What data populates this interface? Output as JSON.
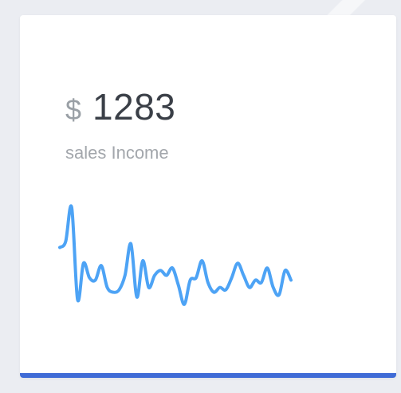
{
  "widget": {
    "currency_symbol": "$",
    "amount": "1283",
    "label": "sales Income"
  },
  "colors": {
    "line": "#4da3f5",
    "accent_bar": "#3f6bd6",
    "background": "#ebedf2",
    "card": "#ffffff"
  },
  "chart_data": {
    "type": "line",
    "title": "",
    "xlabel": "",
    "ylabel": "",
    "x": [
      0,
      1,
      2,
      3,
      4,
      5,
      6,
      7,
      8,
      9,
      10,
      11,
      12,
      13,
      14,
      15,
      16,
      17,
      18,
      19,
      20,
      21,
      22,
      23,
      24,
      25,
      26,
      27,
      28,
      29,
      30,
      31,
      32,
      33,
      34,
      35,
      36,
      37,
      38,
      39
    ],
    "values": [
      55,
      60,
      88,
      12,
      42,
      30,
      28,
      40,
      22,
      18,
      20,
      32,
      58,
      14,
      44,
      22,
      32,
      36,
      32,
      38,
      24,
      8,
      28,
      30,
      44,
      26,
      18,
      22,
      20,
      30,
      42,
      32,
      22,
      28,
      26,
      38,
      22,
      16,
      36,
      28
    ],
    "ylim": [
      0,
      100
    ],
    "grid": false,
    "legend": "none"
  }
}
